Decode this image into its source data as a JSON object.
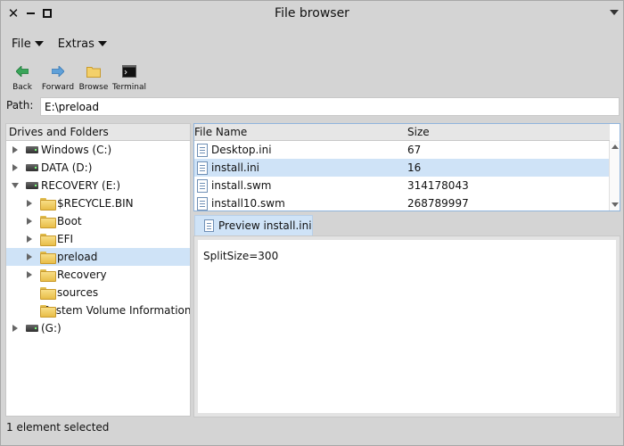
{
  "window": {
    "title": "File browser"
  },
  "menubar": {
    "items": [
      {
        "label": "File"
      },
      {
        "label": "Extras"
      }
    ]
  },
  "toolbar": {
    "items": [
      {
        "label": "Back",
        "icon": "back-arrow-icon"
      },
      {
        "label": "Forward",
        "icon": "forward-arrow-icon"
      },
      {
        "label": "Browse",
        "icon": "folder-icon"
      },
      {
        "label": "Terminal",
        "icon": "terminal-icon"
      }
    ]
  },
  "path": {
    "label": "Path:",
    "value": "E:\\preload"
  },
  "tree": {
    "header": "Drives and Folders",
    "nodes": [
      {
        "label": "Windows (C:)",
        "type": "drive",
        "expanded": false
      },
      {
        "label": "DATA (D:)",
        "type": "drive",
        "expanded": false
      },
      {
        "label": "RECOVERY (E:)",
        "type": "drive",
        "expanded": true
      },
      {
        "label": "$RECYCLE.BIN",
        "type": "folder"
      },
      {
        "label": "Boot",
        "type": "folder"
      },
      {
        "label": "EFI",
        "type": "folder"
      },
      {
        "label": "preload",
        "type": "folder",
        "selected": true
      },
      {
        "label": "Recovery",
        "type": "folder"
      },
      {
        "label": "sources",
        "type": "folder"
      },
      {
        "label": "System Volume Information",
        "type": "folder"
      },
      {
        "label": "(G:)",
        "type": "drive",
        "expanded": false
      }
    ]
  },
  "files": {
    "columns": {
      "name": "File Name",
      "size": "Size"
    },
    "rows": [
      {
        "name": "Desktop.ini",
        "size": "67"
      },
      {
        "name": "install.ini",
        "size": "16",
        "selected": true
      },
      {
        "name": "install.swm",
        "size": "314178043"
      },
      {
        "name": "install10.swm",
        "size": "268789997"
      }
    ]
  },
  "preview": {
    "tab_label": "Preview install.ini",
    "content": "SplitSize=300"
  },
  "status": {
    "text": "1 element selected"
  },
  "colors": {
    "selection": "#cfe3f7",
    "chrome": "#d4d4d4"
  }
}
